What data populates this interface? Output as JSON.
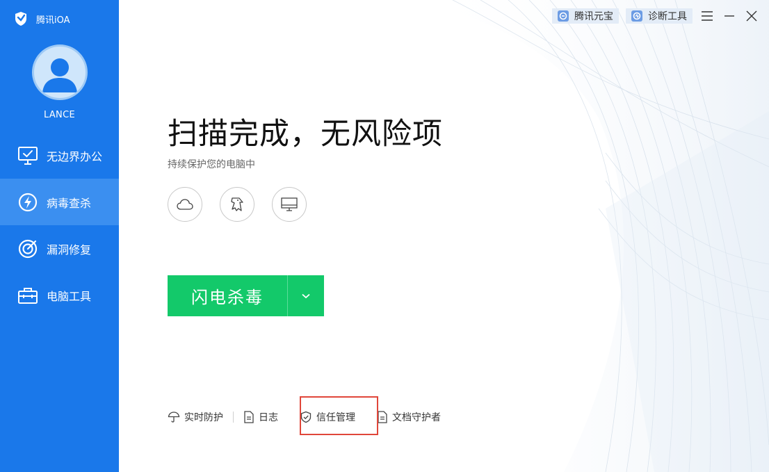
{
  "app": {
    "title": "腾讯iOA",
    "username": "LANCE"
  },
  "sidebar": {
    "items": [
      {
        "label": "无边界办公",
        "icon": "monitor-check-icon",
        "active": false
      },
      {
        "label": "病毒查杀",
        "icon": "lightning-shield-icon",
        "active": true
      },
      {
        "label": "漏洞修复",
        "icon": "target-icon",
        "active": false
      },
      {
        "label": "电脑工具",
        "icon": "toolbox-icon",
        "active": false
      }
    ]
  },
  "topbar": {
    "yuanbao_label": "腾讯元宝",
    "diagnose_label": "诊断工具"
  },
  "main": {
    "headline": "扫描完成，无风险项",
    "subline": "持续保护您的电脑中",
    "status_icons": [
      "cloud-icon",
      "hawk-icon",
      "monitor-icon"
    ],
    "scan_button_label": "闪电杀毒"
  },
  "bottom": {
    "links": [
      {
        "label": "实时防护",
        "icon": "umbrella-icon"
      },
      {
        "label": "日志",
        "icon": "document-icon"
      },
      {
        "label": "信任管理",
        "icon": "shield-check-icon"
      },
      {
        "label": "文档守护者",
        "icon": "document-icon"
      }
    ]
  },
  "colors": {
    "sidebar": "#1a78ea",
    "sidebar_active": "#3b8ff0",
    "primary_button": "#13c96a",
    "highlight_box": "#e0463a"
  }
}
